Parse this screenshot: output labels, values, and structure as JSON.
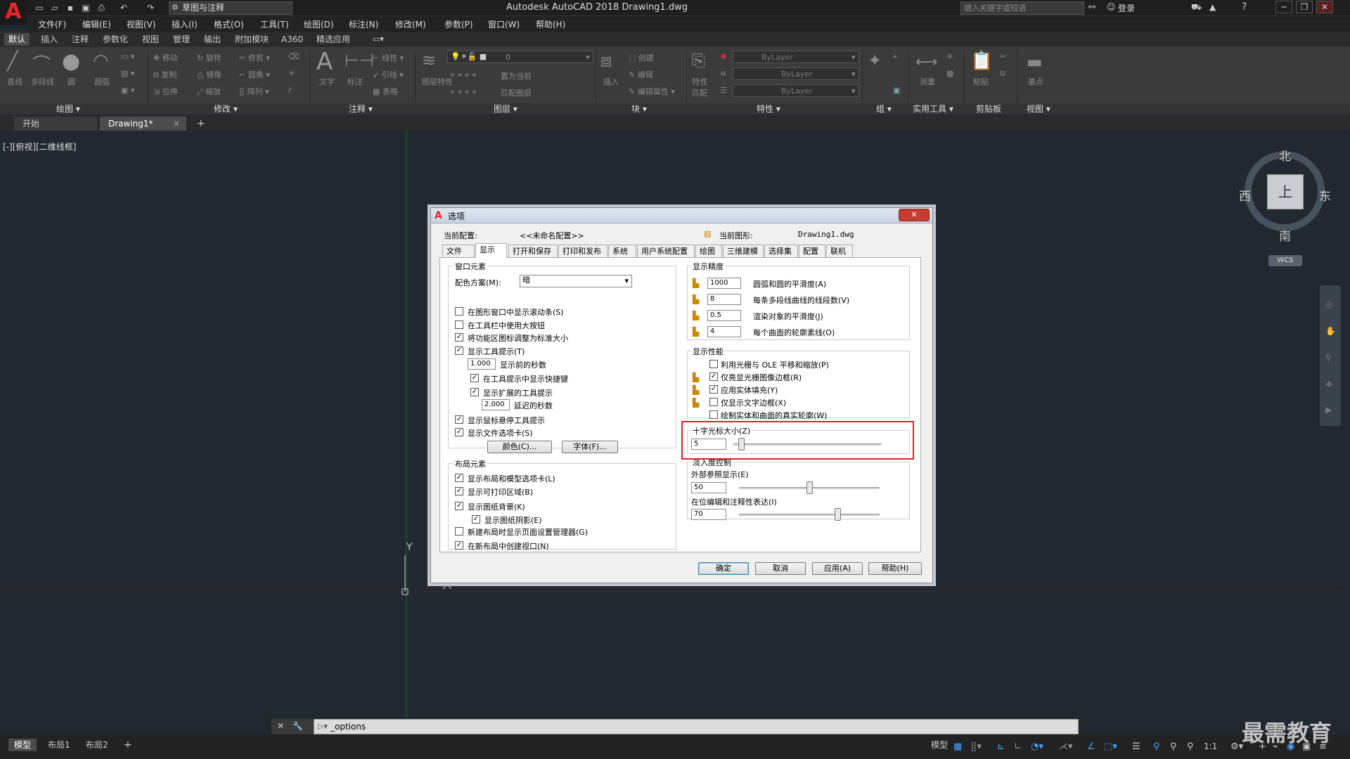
{
  "app": {
    "title": "Autodesk AutoCAD 2018    Drawing1.dwg",
    "logo": "A",
    "workspace": "草图与注释",
    "search_placeholder": "键入关键字或短语",
    "login": "登录"
  },
  "menu": [
    "文件(F)",
    "编辑(E)",
    "视图(V)",
    "插入(I)",
    "格式(O)",
    "工具(T)",
    "绘图(D)",
    "标注(N)",
    "修改(M)",
    "参数(P)",
    "窗口(W)",
    "帮助(H)"
  ],
  "ribbon_tabs": [
    "默认",
    "插入",
    "注释",
    "参数化",
    "视图",
    "管理",
    "输出",
    "附加模块",
    "A360",
    "精选应用"
  ],
  "ribbon_panels": [
    "绘图 ▾",
    "修改 ▾",
    "注释 ▾",
    "图层 ▾",
    "块 ▾",
    "特性 ▾",
    "组 ▾",
    "实用工具 ▾",
    "剪贴板",
    "视图 ▾"
  ],
  "ribbon_tools": {
    "draw": [
      "直线",
      "多段线",
      "圆",
      "圆弧"
    ],
    "modify": [
      "移动",
      "旋转",
      "修剪",
      "复制",
      "镜像",
      "圆角",
      "拉伸",
      "缩放",
      "阵列"
    ],
    "annot": [
      "文字",
      "标注",
      "线性",
      "引线",
      "表格"
    ],
    "layer_name": "0",
    "layer_tools": [
      "图层特性",
      "置为当前",
      "匹配图层"
    ],
    "block": [
      "插入",
      "创建",
      "编辑",
      "编辑属性"
    ],
    "props": [
      "ByLayer",
      "ByLayer",
      "ByLayer"
    ],
    "props_btn": "特性匹配",
    "utils": [
      "测量"
    ],
    "clip": [
      "粘贴"
    ],
    "view": [
      "基点"
    ]
  },
  "doc_tabs": [
    "开始",
    "Drawing1*"
  ],
  "viewport_label": "[-][俯视][二维线框]",
  "viewcube": {
    "north": "北",
    "south": "南",
    "west": "西",
    "east": "东",
    "top": "上",
    "wcs": "WCS"
  },
  "ucs": {
    "y": "Y"
  },
  "dialog": {
    "title": "选项",
    "current_profile_label": "当前配置:",
    "current_profile": "<<未命名配置>>",
    "current_drawing_label": "当前图形:",
    "current_drawing": "Drawing1.dwg",
    "tabs": [
      "文件",
      "显示",
      "打开和保存",
      "打印和发布",
      "系统",
      "用户系统配置",
      "绘图",
      "三维建模",
      "选择集",
      "配置",
      "联机"
    ],
    "window_elements": {
      "title": "窗口元素",
      "color_scheme_label": "配色方案(M):",
      "color_scheme": "暗",
      "checks": [
        {
          "label": "在图形窗口中显示滚动条(S)",
          "checked": ""
        },
        {
          "label": "在工具栏中使用大按钮",
          "checked": ""
        },
        {
          "label": "将功能区图标调整为标准大小",
          "checked": "✓"
        },
        {
          "label": "显示工具提示(T)",
          "checked": "✓"
        }
      ],
      "delay_value": "1.000",
      "delay_label": "显示前的秒数",
      "sub_checks": [
        {
          "label": "在工具提示中显示快捷键",
          "checked": "✓"
        },
        {
          "label": "显示扩展的工具提示",
          "checked": "✓"
        }
      ],
      "ext_delay_value": "2.000",
      "ext_delay_label": "延迟的秒数",
      "checks2": [
        {
          "label": "显示鼠标悬停工具提示",
          "checked": "✓"
        },
        {
          "label": "显示文件选项卡(S)",
          "checked": "✓"
        }
      ],
      "color_btn": "颜色(C)...",
      "font_btn": "字体(F)..."
    },
    "layout_elements": {
      "title": "布局元素",
      "checks": [
        {
          "label": "显示布局和模型选项卡(L)",
          "checked": "✓"
        },
        {
          "label": "显示可打印区域(B)",
          "checked": "✓"
        },
        {
          "label": "显示图纸背景(K)",
          "checked": "✓"
        }
      ],
      "sub_check": {
        "label": "显示图纸阴影(E)",
        "checked": "✓"
      },
      "checks2": [
        {
          "label": "新建布局时显示页面设置管理器(G)",
          "checked": ""
        },
        {
          "label": "在新布局中创建视口(N)",
          "checked": "✓"
        }
      ]
    },
    "display_resolution": {
      "title": "显示精度",
      "rows": [
        {
          "value": "1000",
          "label": "圆弧和圆的平滑度(A)"
        },
        {
          "value": "8",
          "label": "每条多段线曲线的线段数(V)"
        },
        {
          "value": "0.5",
          "label": "渲染对象的平滑度(J)"
        },
        {
          "value": "4",
          "label": "每个曲面的轮廓素线(O)"
        }
      ]
    },
    "display_performance": {
      "title": "显示性能",
      "checks": [
        {
          "label": "利用光栅与 OLE 平移和缩放(P)",
          "checked": ""
        },
        {
          "label": "仅亮显光栅图像边框(R)",
          "checked": "✓"
        },
        {
          "label": "应用实体填充(Y)",
          "checked": "✓"
        },
        {
          "label": "仅显示文字边框(X)",
          "checked": ""
        },
        {
          "label": "绘制实体和曲面的真实轮廓(W)",
          "checked": ""
        }
      ]
    },
    "crosshair": {
      "title": "十字光标大小(Z)",
      "value": "5",
      "fraction": 0.05
    },
    "fade": {
      "title": "淡入度控制",
      "xref_label": "外部参照显示(E)",
      "xref_value": "50",
      "xref_fraction": 0.5,
      "inplace_label": "在位编辑和注释性表达(I)",
      "inplace_value": "70",
      "inplace_fraction": 0.7
    },
    "buttons": {
      "ok": "确定",
      "cancel": "取消",
      "apply": "应用(A)",
      "help": "帮助(H)"
    }
  },
  "command_line": {
    "text": "_options"
  },
  "status": {
    "tabs": [
      "模型",
      "布局1",
      "布局2"
    ],
    "model": "模型",
    "scale": "1:1"
  },
  "watermark": "最需教育"
}
